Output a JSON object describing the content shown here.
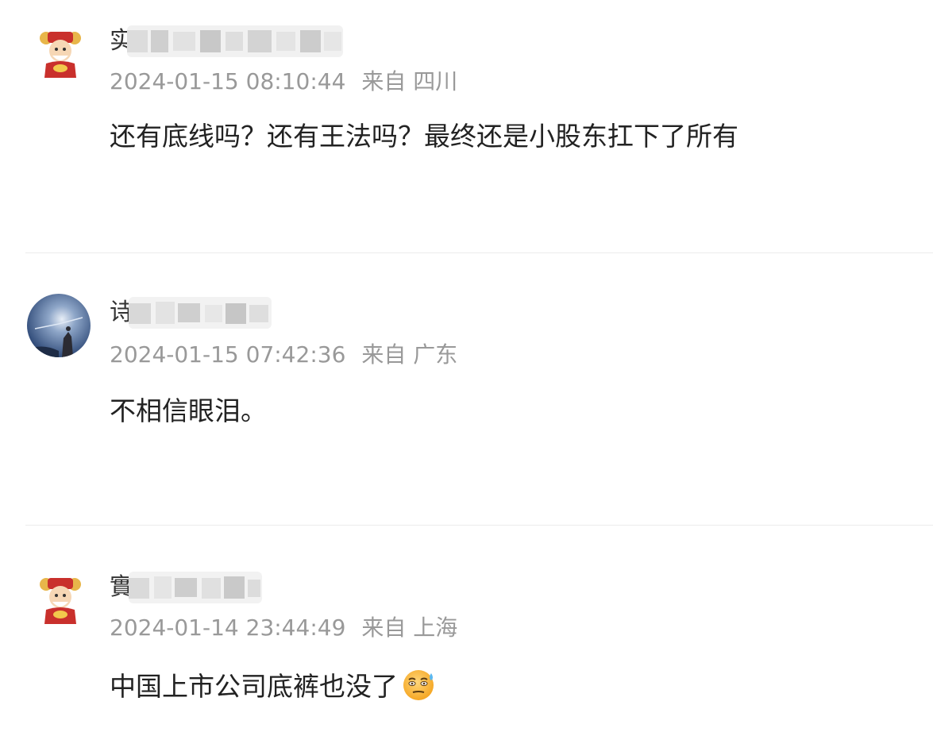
{
  "comments": [
    {
      "username": "实",
      "username_blurred": true,
      "avatar_icon": "fortune-god-avatar-icon",
      "timestamp": "2024-01-15 08:10:44",
      "location": "来自 四川",
      "text": "还有底线吗？还有王法吗？最终还是小股东扛下了所有"
    },
    {
      "username": "诗",
      "username_blurred": true,
      "avatar_icon": "night-sky-avatar-icon",
      "timestamp": "2024-01-15 07:42:36",
      "location": "来自 广东",
      "text": "不相信眼泪。"
    },
    {
      "username": "實",
      "username_blurred": true,
      "avatar_icon": "fortune-god-avatar-icon",
      "timestamp": "2024-01-14 23:44:49",
      "location": "来自 上海",
      "text": "中国上市公司底裤也没了",
      "emoji": "sweat-smile-emoji-icon"
    }
  ],
  "colors": {
    "meta_text": "#999999",
    "body_text": "#222222",
    "divider": "#ececec"
  }
}
